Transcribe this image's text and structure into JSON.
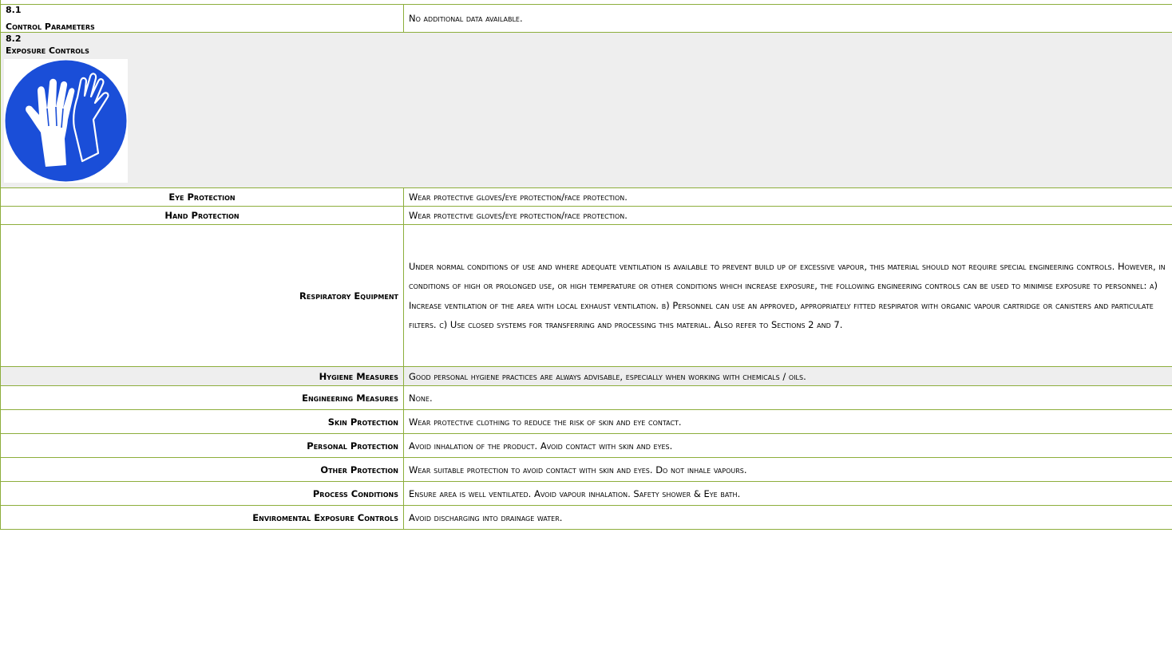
{
  "section_81": {
    "number": "8.1",
    "title": "Control Parameters",
    "value": "No additional data  available."
  },
  "section_82": {
    "number": "8.2",
    "title": "Exposure Controls",
    "pictogram": "gloves-icon"
  },
  "rows": [
    {
      "label": "Eye Protection",
      "value": "Wear protective gloves/eye protection/face protection."
    },
    {
      "label": "Hand Protection",
      "value": "Wear protective gloves/eye protection/face protection."
    },
    {
      "label": "Respiratory Equipment",
      "value": "Under normal conditions of use and where adequate ventilation is available to prevent build up of excessive vapour, this material should not require special engineering controls. However, in conditions of high or prolonged use, or high temperature or other conditions which increase exposure, the following engineering controls can be used to minimise exposure to personnel: a) Increase ventilation of the area with local exhaust ventilation. b) Personnel can use an approved, appropriately fitted respirator with organic vapour cartridge or canisters and particulate filters. c) Use closed systems for transferring and processing this material. Also refer to Sections 2 and 7."
    },
    {
      "label": "Hygiene Measures",
      "value": "Good personal hygiene practices are always advisable, especially when working with chemicals / oils."
    },
    {
      "label": "Engineering Measures",
      "value": "None."
    },
    {
      "label": "Skin Protection",
      "value": "Wear protective clothing to reduce the risk of skin and eye contact."
    },
    {
      "label": "Personal Protection",
      "value": "Avoid inhalation of the product. Avoid contact with skin and eyes."
    },
    {
      "label": "Other Protection",
      "value": "Wear suitable protection to avoid contact with skin and eyes. Do not inhale vapours."
    },
    {
      "label": "Process Conditions",
      "value": "Ensure area is well ventilated. Avoid vapour inhalation. Safety shower & Eye bath."
    },
    {
      "label": "Enviromental Exposure Controls",
      "value": "Avoid discharging into drainage water."
    }
  ],
  "colors": {
    "border": "#8dae3c",
    "shade": "#eeeeee",
    "ppe_blue": "#1a4ed8"
  }
}
